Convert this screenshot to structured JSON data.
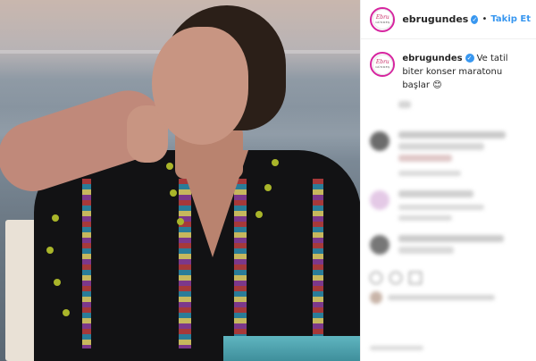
{
  "post": {
    "username": "ebrugundes",
    "follow_label": "Takip Et",
    "dot_separator": "•",
    "verified_mark": "✓",
    "caption": "Ve tatil biter konser maratonu başlar 😊",
    "avatar_logo": {
      "line1": "Ebru",
      "line2": "GÜNDEŞ"
    }
  },
  "colors": {
    "link_blue": "#3897f0",
    "text": "#262626",
    "story_ring": "#d6249f"
  },
  "icons": [
    "verified-badge-icon",
    "smile-emoji"
  ]
}
